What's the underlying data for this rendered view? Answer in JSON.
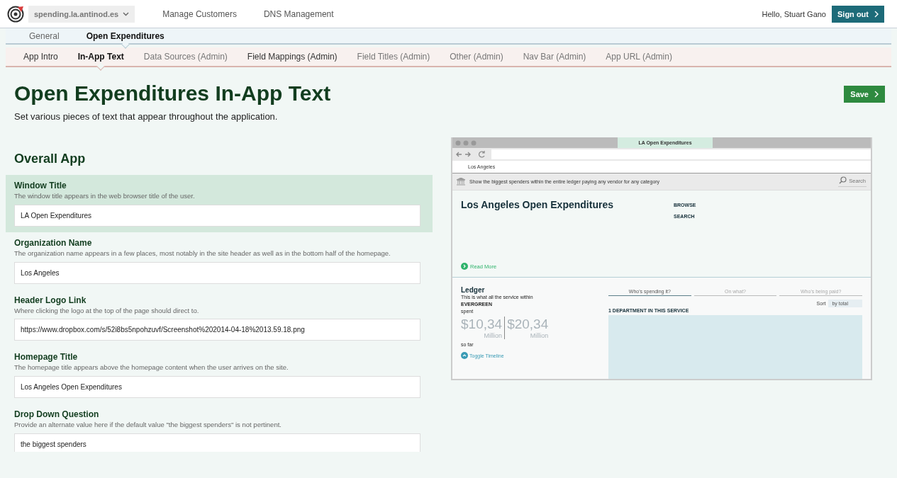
{
  "top_bar": {
    "site_selector": "spending.la.antinod.es",
    "links": [
      "Manage Customers",
      "DNS Management"
    ],
    "greeting": "Hello, Stuart Gano",
    "sign_out": "Sign out"
  },
  "nav_primary": [
    {
      "label": "General",
      "selected": false
    },
    {
      "label": "Open Expenditures",
      "selected": true
    }
  ],
  "nav_secondary": [
    {
      "label": "App Intro",
      "selected": false,
      "admin": false
    },
    {
      "label": "In-App Text",
      "selected": true,
      "admin": false
    },
    {
      "label": "Data Sources (Admin)",
      "selected": false,
      "admin": true
    },
    {
      "label": "Field Mappings (Admin)",
      "selected": false,
      "admin": false
    },
    {
      "label": "Field Titles (Admin)",
      "selected": false,
      "admin": true
    },
    {
      "label": "Other (Admin)",
      "selected": false,
      "admin": true
    },
    {
      "label": "Nav Bar (Admin)",
      "selected": false,
      "admin": true
    },
    {
      "label": "App URL (Admin)",
      "selected": false,
      "admin": true
    }
  ],
  "page": {
    "title": "Open Expenditures In-App Text",
    "subtitle": "Set various pieces of text that appear throughout the application.",
    "save": "Save"
  },
  "section": {
    "title": "Overall App",
    "fields": [
      {
        "label": "Window Title",
        "help": "The window title appears in the web browser title of the user.",
        "value": "LA Open Expenditures",
        "selected": true
      },
      {
        "label": "Organization Name",
        "help": "The organization name appears in a few places, most notably in the site header as well as in the bottom half of the homepage.",
        "value": "Los Angeles",
        "selected": false
      },
      {
        "label": "Header Logo Link",
        "help": "Where clicking the logo at the top of the page should direct to.",
        "value": "https://www.dropbox.com/s/52i8bs5npohzuvf/Screenshot%202014-04-18%2013.59.18.png",
        "selected": false
      },
      {
        "label": "Homepage Title",
        "help": "The homepage title appears above the homepage content when the user arrives on the site.",
        "value": "Los Angeles Open Expenditures",
        "selected": false
      },
      {
        "label": "Drop Down Question",
        "help": "Provide an alternate value here if the default value \"the biggest spenders\" is not pertinent.",
        "value": "the biggest spenders",
        "selected": false
      }
    ]
  },
  "preview": {
    "tab_title": "LA Open Expenditures",
    "site_header": "Los Angeles",
    "question": "Show the biggest spenders within the entire ledger paying any vendor for any category",
    "search": "Search",
    "title": "Los Angeles Open Expenditures",
    "menu": [
      "BROWSE",
      "SEARCH"
    ],
    "read_more": "Read More",
    "ledger": {
      "title": "Ledger",
      "line1": "This is what all the service within",
      "org": "EVERGREEN",
      "line2": "spent",
      "amounts": [
        {
          "value": "$10,34",
          "unit": "Million"
        },
        {
          "value": "$20,34",
          "unit": "Million"
        }
      ],
      "so_far": "so far",
      "toggle": "Toggle Timeline"
    },
    "tabs": [
      {
        "label": "Who's spending it?",
        "selected": true
      },
      {
        "label": "On what?",
        "selected": false
      },
      {
        "label": "Who's being paid?",
        "selected": false
      }
    ],
    "sort_label": "Sort",
    "sort_value": "by total",
    "count": "1 DEPARTMENT IN THIS SERVICE"
  }
}
